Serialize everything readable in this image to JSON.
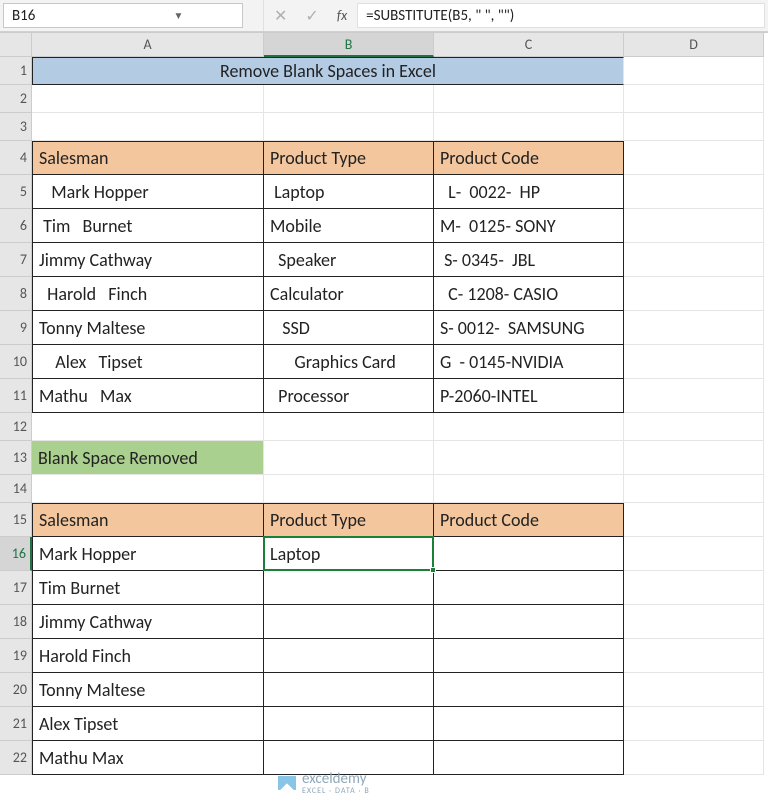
{
  "nameBox": "B16",
  "formula": "=SUBSTITUTE(B5, \" \", \"\")",
  "columns": [
    "A",
    "B",
    "C",
    "D"
  ],
  "rowCount": 22,
  "selectedCell": {
    "col": "B",
    "row": 16
  },
  "title": "Remove Blank Spaces in Excel",
  "table1": {
    "headers": [
      "Salesman",
      "Product Type",
      "Product Code"
    ],
    "rows": [
      [
        "   Mark Hopper",
        " Laptop",
        "  L-  0022-  HP"
      ],
      [
        " Tim   Burnet",
        "Mobile",
        "M-  0125- SONY"
      ],
      [
        "Jimmy Cathway",
        "  Speaker",
        " S- 0345-  JBL"
      ],
      [
        "  Harold   Finch",
        "Calculator",
        "  C- 1208- CASIO"
      ],
      [
        "Tonny Maltese",
        "   SSD",
        "S- 0012-  SAMSUNG"
      ],
      [
        "    Alex   Tipset",
        "      Graphics Card",
        "G  - 0145-NVIDIA"
      ],
      [
        "Mathu   Max",
        "  Processor",
        "P-2060-INTEL"
      ]
    ]
  },
  "sectionLabel": "Blank Space Removed",
  "table2": {
    "headers": [
      "Salesman",
      "Product Type",
      "Product Code"
    ],
    "rows": [
      [
        "Mark Hopper",
        "Laptop",
        ""
      ],
      [
        "Tim Burnet",
        "",
        ""
      ],
      [
        "Jimmy Cathway",
        "",
        ""
      ],
      [
        "Harold Finch",
        "",
        ""
      ],
      [
        "Tonny Maltese",
        "",
        ""
      ],
      [
        "Alex Tipset",
        "",
        ""
      ],
      [
        "Mathu Max",
        "",
        ""
      ]
    ]
  },
  "watermark": {
    "brand": "exceldemy",
    "tag": "EXCEL · DATA · B"
  }
}
